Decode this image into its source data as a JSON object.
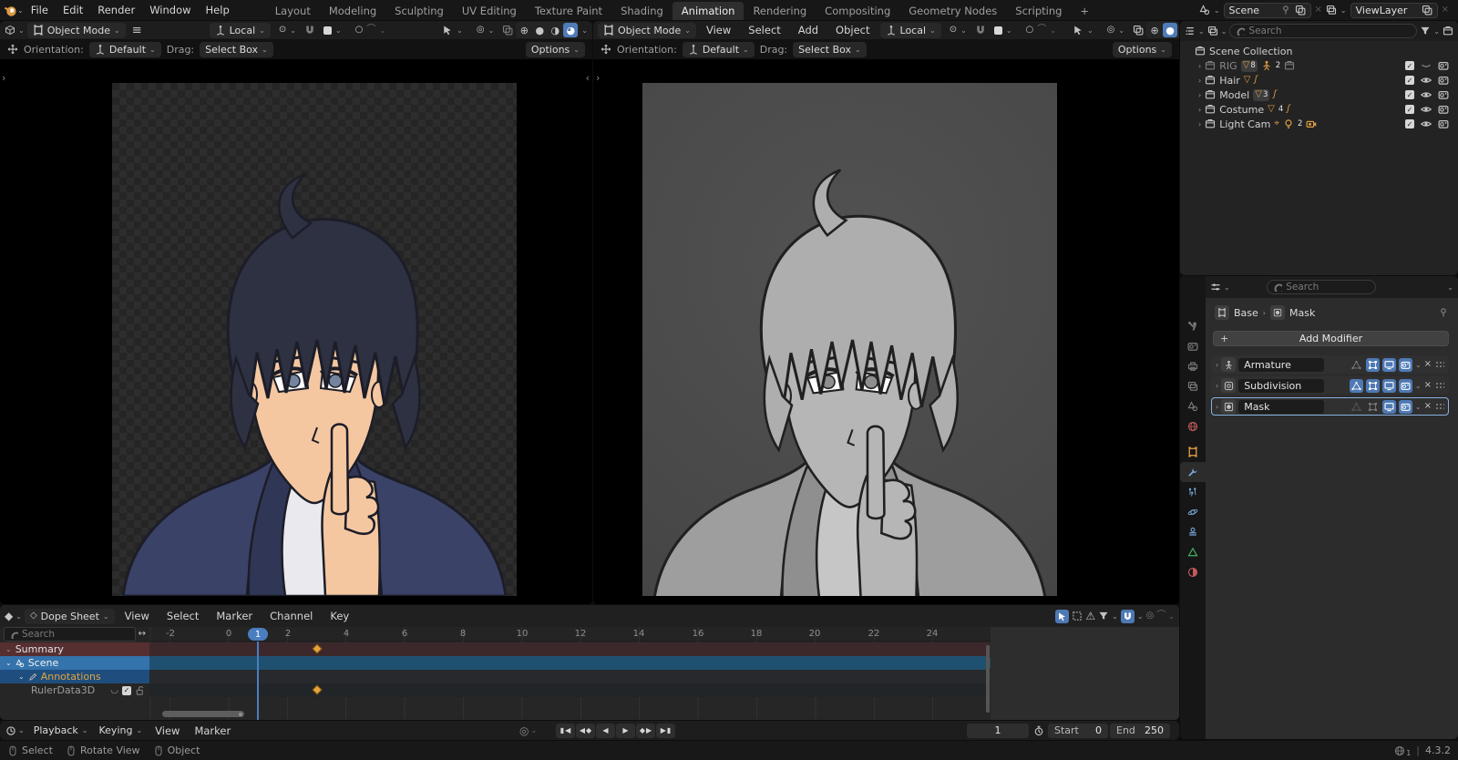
{
  "topbar": {
    "menus": [
      "File",
      "Edit",
      "Render",
      "Window",
      "Help"
    ],
    "workspaces": [
      "Layout",
      "Modeling",
      "Sculpting",
      "UV Editing",
      "Texture Paint",
      "Shading",
      "Animation",
      "Rendering",
      "Compositing",
      "Geometry Nodes",
      "Scripting"
    ],
    "add_workspace": "+",
    "scene_value": "Scene",
    "viewlayer_value": "ViewLayer"
  },
  "viewport": {
    "mode": "Object Mode",
    "menus": [
      "View",
      "Select",
      "Add",
      "Object"
    ],
    "transform_orientation": "Local",
    "tool": {
      "orientation_label": "Orientation:",
      "orientation_value": "Default",
      "drag_label": "Drag:",
      "drag_value": "Select Box",
      "options": "Options"
    }
  },
  "outliner": {
    "search_placeholder": "Search",
    "root": "Scene Collection",
    "rows": [
      {
        "label": "RIG",
        "mesh_count": "8",
        "armature_count": "2"
      },
      {
        "label": "Hair"
      },
      {
        "label": "Model",
        "mesh_count": "3"
      },
      {
        "label": "Costume",
        "mesh_count": "4"
      },
      {
        "label": "Light Cam",
        "light_count": "2"
      }
    ]
  },
  "properties": {
    "search_placeholder": "Search",
    "breadcrumb_object": "Base",
    "breadcrumb_data": "Mask",
    "add_modifier": "Add Modifier",
    "modifiers": [
      {
        "name": "Armature"
      },
      {
        "name": "Subdivision"
      },
      {
        "name": "Mask"
      }
    ]
  },
  "dopesheet": {
    "editor": "Dope Sheet",
    "menus": [
      "View",
      "Select",
      "Marker",
      "Channel",
      "Key"
    ],
    "search_placeholder": "Search",
    "channels": [
      "Summary",
      "Scene",
      "Annotations",
      "RulerData3D"
    ],
    "ruler": [
      "-2",
      "0",
      "2",
      "4",
      "6",
      "8",
      "10",
      "12",
      "14",
      "16",
      "18",
      "20",
      "22",
      "24"
    ],
    "current_frame": "1"
  },
  "timeline": {
    "menus": [
      "Playback",
      "Keying",
      "View",
      "Marker"
    ],
    "frame": "1",
    "start_label": "Start",
    "start_value": "0",
    "end_label": "End",
    "end_value": "250"
  },
  "statusbar": {
    "hints": [
      "Select",
      "Rotate View",
      "Object"
    ],
    "online_count": "1",
    "version": "4.3.2"
  },
  "colors": {
    "accent_blue": "#4f84c4",
    "selection_blue": "#3a6ea5",
    "keyframe_orange": "#e8a33d",
    "object_orange": "#dc9b45",
    "data_green": "#44b05c",
    "world_red": "#c4595c"
  }
}
